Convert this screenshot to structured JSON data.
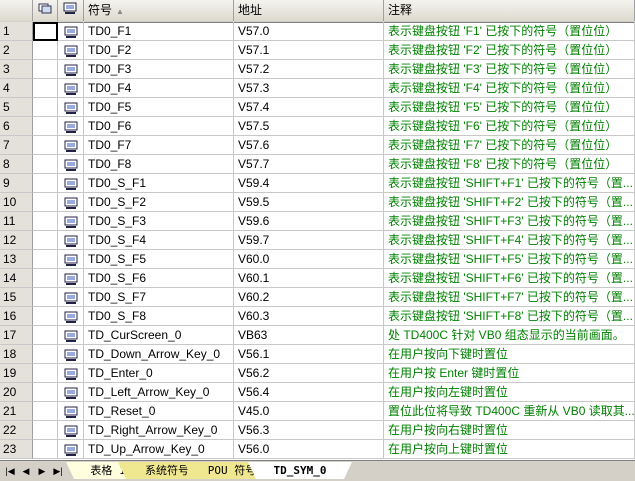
{
  "header": {
    "symbol": "符号",
    "address": "地址",
    "comment": "注释"
  },
  "rows": [
    {
      "num": "1",
      "symbol": "TD0_F1",
      "address": "V57.0",
      "comment": "表示键盘按钮 'F1' 已按下的符号（置位位）"
    },
    {
      "num": "2",
      "symbol": "TD0_F2",
      "address": "V57.1",
      "comment": "表示键盘按钮 'F2' 已按下的符号（置位位）"
    },
    {
      "num": "3",
      "symbol": "TD0_F3",
      "address": "V57.2",
      "comment": "表示键盘按钮 'F3' 已按下的符号（置位位）"
    },
    {
      "num": "4",
      "symbol": "TD0_F4",
      "address": "V57.3",
      "comment": "表示键盘按钮 'F4' 已按下的符号（置位位）"
    },
    {
      "num": "5",
      "symbol": "TD0_F5",
      "address": "V57.4",
      "comment": "表示键盘按钮 'F5' 已按下的符号（置位位）"
    },
    {
      "num": "6",
      "symbol": "TD0_F6",
      "address": "V57.5",
      "comment": "表示键盘按钮 'F6' 已按下的符号（置位位）"
    },
    {
      "num": "7",
      "symbol": "TD0_F7",
      "address": "V57.6",
      "comment": "表示键盘按钮 'F7' 已按下的符号（置位位）"
    },
    {
      "num": "8",
      "symbol": "TD0_F8",
      "address": "V57.7",
      "comment": "表示键盘按钮 'F8' 已按下的符号（置位位）"
    },
    {
      "num": "9",
      "symbol": "TD0_S_F1",
      "address": "V59.4",
      "comment": "表示键盘按钮 'SHIFT+F1' 已按下的符号（置..."
    },
    {
      "num": "10",
      "symbol": "TD0_S_F2",
      "address": "V59.5",
      "comment": "表示键盘按钮 'SHIFT+F2' 已按下的符号（置..."
    },
    {
      "num": "11",
      "symbol": "TD0_S_F3",
      "address": "V59.6",
      "comment": "表示键盘按钮 'SHIFT+F3' 已按下的符号（置..."
    },
    {
      "num": "12",
      "symbol": "TD0_S_F4",
      "address": "V59.7",
      "comment": "表示键盘按钮 'SHIFT+F4' 已按下的符号（置..."
    },
    {
      "num": "13",
      "symbol": "TD0_S_F5",
      "address": "V60.0",
      "comment": "表示键盘按钮 'SHIFT+F5' 已按下的符号（置..."
    },
    {
      "num": "14",
      "symbol": "TD0_S_F6",
      "address": "V60.1",
      "comment": "表示键盘按钮 'SHIFT+F6' 已按下的符号（置..."
    },
    {
      "num": "15",
      "symbol": "TD0_S_F7",
      "address": "V60.2",
      "comment": "表示键盘按钮 'SHIFT+F7' 已按下的符号（置..."
    },
    {
      "num": "16",
      "symbol": "TD0_S_F8",
      "address": "V60.3",
      "comment": "表示键盘按钮 'SHIFT+F8' 已按下的符号（置..."
    },
    {
      "num": "17",
      "symbol": "TD_CurScreen_0",
      "address": "VB63",
      "comment": "处 TD400C 针对 VB0 组态显示的当前画面。"
    },
    {
      "num": "18",
      "symbol": "TD_Down_Arrow_Key_0",
      "address": "V56.1",
      "comment": "在用户按向下键时置位"
    },
    {
      "num": "19",
      "symbol": "TD_Enter_0",
      "address": "V56.2",
      "comment": "在用户按 Enter 键时置位"
    },
    {
      "num": "20",
      "symbol": "TD_Left_Arrow_Key_0",
      "address": "V56.4",
      "comment": "在用户按向左键时置位"
    },
    {
      "num": "21",
      "symbol": "TD_Reset_0",
      "address": "V45.0",
      "comment": "置位此位将导致 TD400C 重新从 VB0 读取其..."
    },
    {
      "num": "22",
      "symbol": "TD_Right_Arrow_Key_0",
      "address": "V56.3",
      "comment": "在用户按向右键时置位"
    },
    {
      "num": "23",
      "symbol": "TD_Up_Arrow_Key_0",
      "address": "V56.0",
      "comment": "在用户按向上键时置位"
    }
  ],
  "tabs": [
    {
      "label": "表格 1"
    },
    {
      "label": "系统符号"
    },
    {
      "label": "POU 符号"
    },
    {
      "label": "TD_SYM_0"
    }
  ],
  "colors": {
    "comment_text": "#008000",
    "header_bg": "#d4d0c8"
  }
}
